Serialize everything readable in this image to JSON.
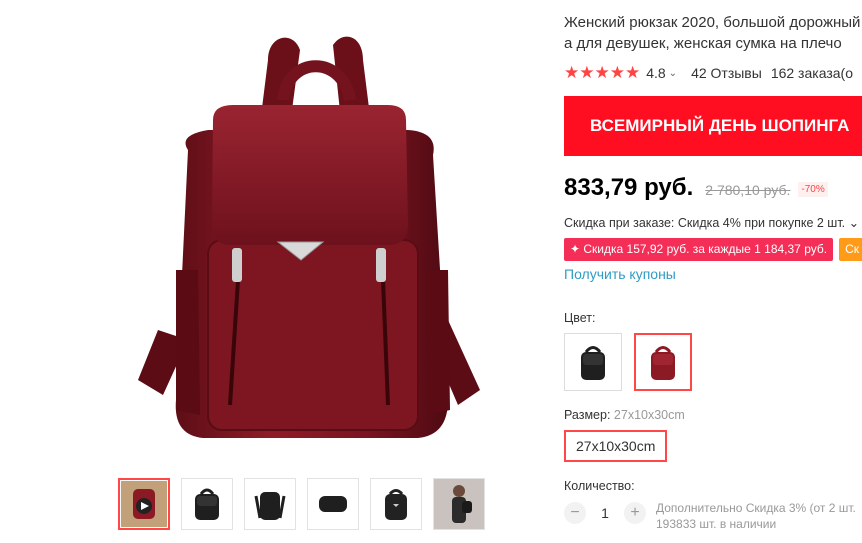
{
  "product": {
    "title_line1": "Женский рюкзак 2020, большой дорожный",
    "title_line2": "а для девушек, женская сумка на плечо",
    "stars": "★★★★★",
    "rating": "4.8",
    "reviews": "42 Отзывы",
    "orders": "162 заказа(о"
  },
  "banner": {
    "text": "ВСЕМИРНЫЙ ДЕНЬ ШОПИНГА"
  },
  "price": {
    "current": "833,79 руб.",
    "old": "2 780,10 руб.",
    "discount": "-70%"
  },
  "order_discount": "Скидка при заказе: Скидка 4% при покупке 2 шт. ⌄",
  "promo": {
    "tag1": "✦ Скидка 157,92 руб. за каждые 1 184,37 руб.",
    "tag2": "Ск"
  },
  "coupons_link": "Получить купоны",
  "color": {
    "label": "Цвет:",
    "options": [
      "black",
      "wine-red"
    ],
    "selected": "wine-red"
  },
  "size": {
    "label": "Размер:",
    "selected_text": "27x10x30cm",
    "option": "27x10x30cm"
  },
  "quantity": {
    "label": "Количество:",
    "minus": "−",
    "value": "1",
    "plus": "+",
    "note_line1": "Дополнительно Скидка 3% (от 2 шт.",
    "note_line2": "193833 шт. в наличии"
  },
  "colors": {
    "accent": "#ff4747",
    "banner": "#ff0d21",
    "link": "#2e9cc3",
    "bag_red": "#8b1a25",
    "bag_black": "#1f1f1f"
  },
  "thumbnails": [
    "red-backpack-video",
    "black-backpack-front",
    "black-backpack-side",
    "black-backpack-bottom",
    "black-backpack-angle",
    "model-wearing-backpack"
  ]
}
